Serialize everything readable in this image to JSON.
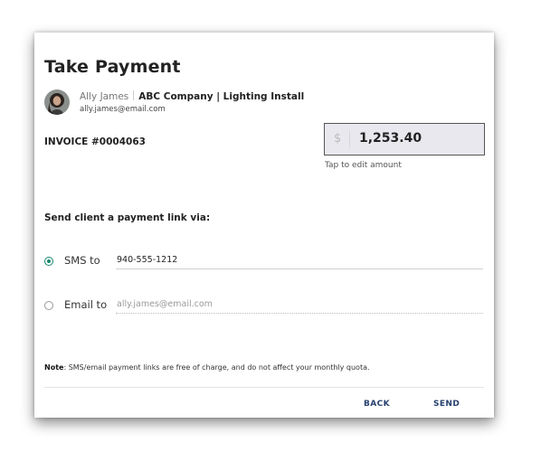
{
  "dialog": {
    "title": "Take Payment"
  },
  "client": {
    "name": "Ally James",
    "company": "ABC Company | Lighting Install",
    "email": "ally.james@email.com"
  },
  "invoice": {
    "label": "INVOICE #0004063"
  },
  "amount": {
    "currency_symbol": "$",
    "value": "1,253.40",
    "hint": "Tap to edit amount"
  },
  "send_via": {
    "label": "Send client a payment link via:",
    "sms": {
      "label": "SMS to",
      "value": "940-555-1212",
      "selected": true
    },
    "email": {
      "label": "Email to",
      "placeholder": "ally.james@email.com",
      "selected": false
    }
  },
  "note": {
    "prefix": "Note",
    "text": ": SMS/email payment links are free of charge, and do not affect your monthly quota."
  },
  "actions": {
    "back_label": "BACK",
    "send_label": "SEND"
  },
  "colors": {
    "accent": "#16856e",
    "action_text": "#27406e"
  }
}
